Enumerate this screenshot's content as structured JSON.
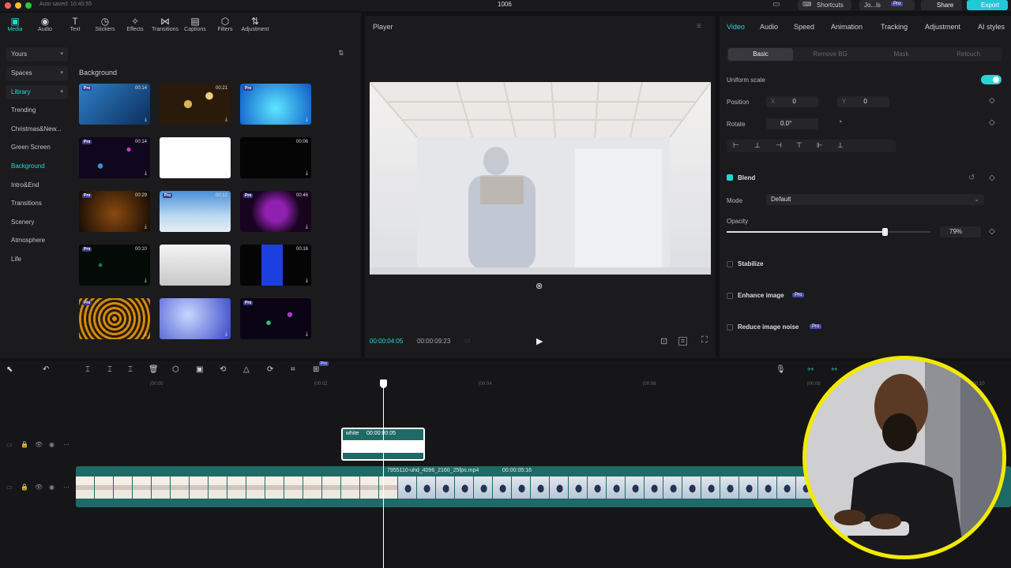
{
  "topbar": {
    "autosave": "Auto saved: 10:40:55",
    "project_title": "1006",
    "shortcuts": "Shortcuts",
    "user": "Jo...ls",
    "pro_badge": "Pro",
    "share": "Share",
    "export": "Export"
  },
  "toolbar": [
    {
      "label": "Media",
      "icon": "media-icon"
    },
    {
      "label": "Audio",
      "icon": "audio-icon"
    },
    {
      "label": "Text",
      "icon": "text-icon"
    },
    {
      "label": "Stickers",
      "icon": "stickers-icon"
    },
    {
      "label": "Effects",
      "icon": "effects-icon"
    },
    {
      "label": "Transitions",
      "icon": "transitions-icon"
    },
    {
      "label": "Captions",
      "icon": "captions-icon"
    },
    {
      "label": "Filters",
      "icon": "filters-icon"
    },
    {
      "label": "Adjustment",
      "icon": "adjustment-icon"
    }
  ],
  "sidebar": {
    "items": [
      "Yours",
      "Spaces",
      "Library",
      "Trending",
      "Christmas&New...",
      "Green Screen",
      "Background",
      "Intro&End",
      "Transitions",
      "Scenery",
      "Atmosphere",
      "Life"
    ]
  },
  "library": {
    "section_title": "Background",
    "sort_icon": "sort-icon",
    "thumbs": [
      {
        "dur": "00:14",
        "pro": true
      },
      {
        "dur": "00:21",
        "pro": false
      },
      {
        "dur": "",
        "pro": true
      },
      {
        "dur": "00:14",
        "pro": true
      },
      {
        "dur": "",
        "pro": false
      },
      {
        "dur": "00:06",
        "pro": false
      },
      {
        "dur": "00:29",
        "pro": true
      },
      {
        "dur": "00:12",
        "pro": true
      },
      {
        "dur": "00:46",
        "pro": true
      },
      {
        "dur": "00:10",
        "pro": true
      },
      {
        "dur": "",
        "pro": false
      },
      {
        "dur": "00:16",
        "pro": false
      },
      {
        "dur": "",
        "pro": true
      },
      {
        "dur": "",
        "pro": false
      },
      {
        "dur": "",
        "pro": true
      }
    ],
    "pro_label": "Pro"
  },
  "player": {
    "title": "Player",
    "current_time": "00:00:04:05",
    "total_time": "00:00:09:23"
  },
  "right": {
    "tabs": [
      "Video",
      "Audio",
      "Speed",
      "Animation",
      "Tracking",
      "Adjustment",
      "AI styles"
    ],
    "subtabs": [
      "Basic",
      "Remove BG",
      "Mask",
      "Retouch"
    ],
    "uniform_scale": "Uniform scale",
    "position_label": "Position",
    "x_label": "X",
    "x_value": "0",
    "y_label": "Y",
    "y_value": "0",
    "rotate_label": "Rotate",
    "rotate_value": "0.0°",
    "blend_label": "Blend",
    "mode_label": "Mode",
    "mode_value": "Default",
    "opacity_label": "Opacity",
    "opacity_value": "79%",
    "opacity_fraction": 0.79,
    "stabilize": "Stabilize",
    "enhance": "Enhance image",
    "reduce_noise": "Reduce image noise",
    "pro": "Pro"
  },
  "timeline": {
    "ruler": [
      "|00:00",
      "|00:02",
      "|00:04",
      "|00:06",
      "|00:08",
      "|00:10"
    ],
    "white_clip_label": "white",
    "white_clip_duration": "00:00:00:05",
    "main_clip_label": "7955110-uhd_4096_2160_25fps.mp4",
    "main_clip_duration": "00:00:05:16"
  },
  "colors": {
    "accent": "#2bd4d4",
    "export": "#21c8d6",
    "clip": "#1e6a66",
    "webcam_ring": "#f2ea00"
  }
}
